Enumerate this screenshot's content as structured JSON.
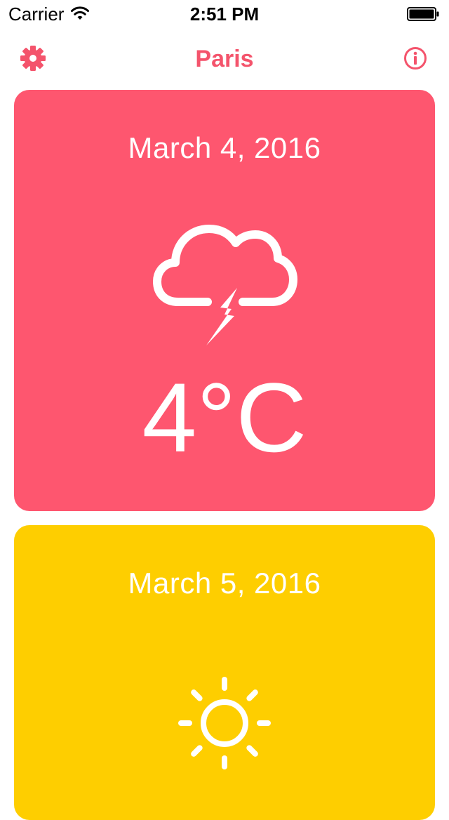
{
  "status_bar": {
    "carrier": "Carrier",
    "time": "2:51 PM",
    "wifi_icon": "wifi-icon",
    "battery_icon": "battery-icon"
  },
  "nav": {
    "title": "Paris",
    "left_icon": "gear-icon",
    "right_icon": "info-icon",
    "accent_color": "#f4546c"
  },
  "forecast": [
    {
      "date": "March 4, 2016",
      "icon": "thunderstorm-icon",
      "temperature": "4°C",
      "color": "#fe566f"
    },
    {
      "date": "March 5, 2016",
      "icon": "sun-icon",
      "color": "#fece00"
    }
  ]
}
